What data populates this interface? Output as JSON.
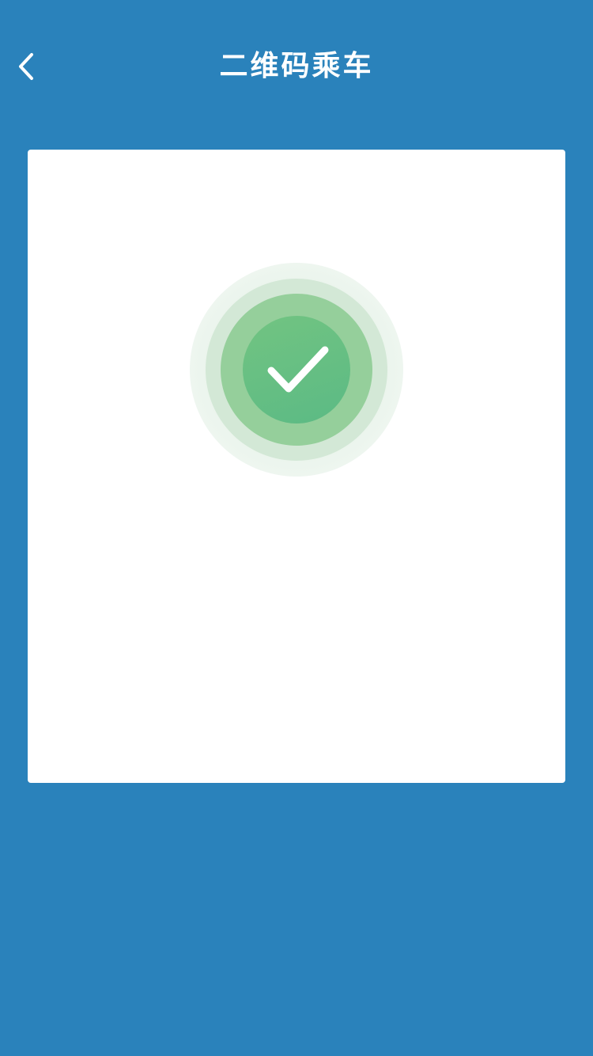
{
  "header": {
    "title": "二维码乘车",
    "back_icon": "chevron-left-icon"
  },
  "card": {
    "status_icon": "check-icon"
  },
  "colors": {
    "background": "#2a82bb",
    "card": "#ffffff",
    "success": "#5bba84"
  }
}
